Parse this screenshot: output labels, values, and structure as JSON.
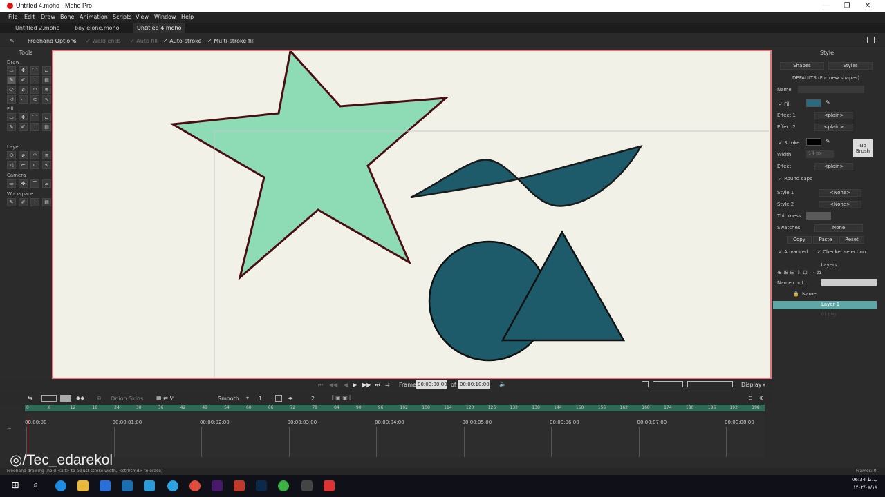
{
  "window": {
    "title": "Untitled 4.moho - Moho Pro",
    "controls": [
      "—",
      "❐",
      "✕"
    ]
  },
  "menu": [
    "File",
    "Edit",
    "Draw",
    "Bone",
    "Animation",
    "Scripts",
    "View",
    "Window",
    "Help"
  ],
  "tabs": [
    "Untitled 2.moho",
    "boy elone.moho",
    "Untitled 4.moho"
  ],
  "options": {
    "tool": "Freehand Options",
    "weld_ends": "Weld ends",
    "auto_fill": "Auto fill",
    "auto_stroke": "Auto-stroke",
    "multi_stroke_fill": "Multi-stroke fill"
  },
  "tools": {
    "title": "Tools",
    "draw": "Draw",
    "fill": "Fill",
    "layer": "Layer",
    "camera": "Camera",
    "workspace": "Workspace"
  },
  "style": {
    "title": "Style",
    "shapes": "Shapes",
    "styles": "Styles",
    "defaults": "DEFAULTS (For new shapes)",
    "name": "Name",
    "fill": "Fill",
    "effect1": "Effect 1",
    "effect2": "Effect 2",
    "plain": "<plain>",
    "stroke": "Stroke",
    "no_brush": "No Brush",
    "width": "Width",
    "width_value": "14 px",
    "effect": "Effect",
    "round_caps": "Round caps",
    "style1": "Style 1",
    "style2": "Style 2",
    "none": "<None>",
    "thickness": "Thickness",
    "swatches": "Swatches",
    "swatches_value": "None",
    "copy": "Copy",
    "paste": "Paste",
    "reset": "Reset",
    "advanced": "Advanced",
    "checker": "Checker selection",
    "fill_color": "#2a6b80",
    "stroke_color": "#000000"
  },
  "layers": {
    "title": "Layers",
    "filter": "Name cont...",
    "col_name": "Name",
    "layer1": "Layer 1",
    "layer2": "01.png"
  },
  "playback": {
    "frame_label": "Frame",
    "frame_value": "00:00:00:00",
    "of": "of",
    "total": "00:00:10:00",
    "display": "Display"
  },
  "timeline": {
    "onion": "Onion Skins",
    "smooth": "Smooth",
    "one": "1",
    "two": "2",
    "ruler": [
      "0",
      "6",
      "12",
      "18",
      "24",
      "30",
      "36",
      "42",
      "48",
      "54",
      "60",
      "66",
      "72",
      "78",
      "84",
      "90",
      "96",
      "102",
      "108",
      "114",
      "120",
      "126",
      "132",
      "138",
      "144",
      "150",
      "156",
      "162",
      "168",
      "174",
      "180",
      "186",
      "192",
      "198"
    ],
    "timecodes": [
      "00:00:00",
      "00:00:01:00",
      "00:00:02:00",
      "00:00:03:00",
      "00:00:04:00",
      "00:00:05:00",
      "00:00:06:00",
      "00:00:07:00",
      "00:00:08:00"
    ]
  },
  "status": {
    "hint": "Freehand drawing (hold <alt> to adjust stroke width, <ctrl/cmd> to erase)",
    "frames": "Frames: 0"
  },
  "watermark": "/Tec_edarekol",
  "clock": {
    "time": "06:34 ب.ظ",
    "date": "۱۴۰۲/۰۷/۱۸"
  },
  "colors": {
    "accent": "#e6737a",
    "star": "#8ddcb6",
    "teal": "#1e5b6a",
    "canvas": "#f1f1e7"
  }
}
